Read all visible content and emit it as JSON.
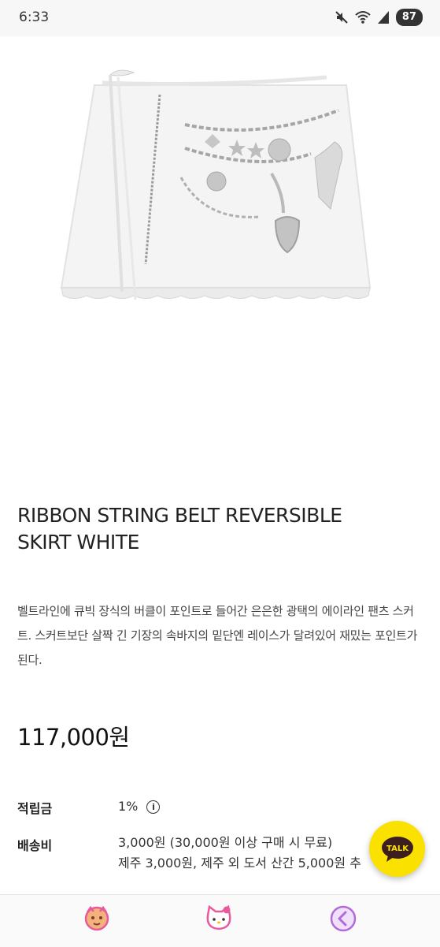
{
  "status_bar": {
    "time": "6:33",
    "battery": "87",
    "icons": [
      "mute-icon",
      "wifi-icon",
      "signal-icon"
    ]
  },
  "product": {
    "image_alt": "white ribbon string belt skirt with silver charm chains",
    "title_line1": "RIBBON STRING BELT REVERSIBLE",
    "title_line2": "SKIRT WHITE",
    "description": "벨트라인에 큐빅 장식의 버클이 포인트로 들어간 은은한 광택의 에이라인 팬츠 스커트. 스커트보단 살짝 긴 기장의 속바지의 밑단엔 레이스가 달려있어 재밌는 포인트가 된다.",
    "price": "117,000원"
  },
  "info": {
    "points_label": "적립금",
    "points_value": "1%",
    "points_info_icon": "i",
    "shipping_label": "배송비",
    "shipping_line1": "3,000원 (30,000원 이상 구매 시 무료)",
    "shipping_line2": "제주 3,000원, 제주 외 도서 산간 5,000원 추"
  },
  "talk_button": {
    "label": "TALK"
  },
  "bottom_nav": {
    "items": [
      "character-icon",
      "hello-kitty-icon",
      "back-icon"
    ]
  },
  "colors": {
    "talk_yellow": "#fae100",
    "nav_pink": "#e85a9e",
    "nav_purple": "#b26bd6"
  }
}
